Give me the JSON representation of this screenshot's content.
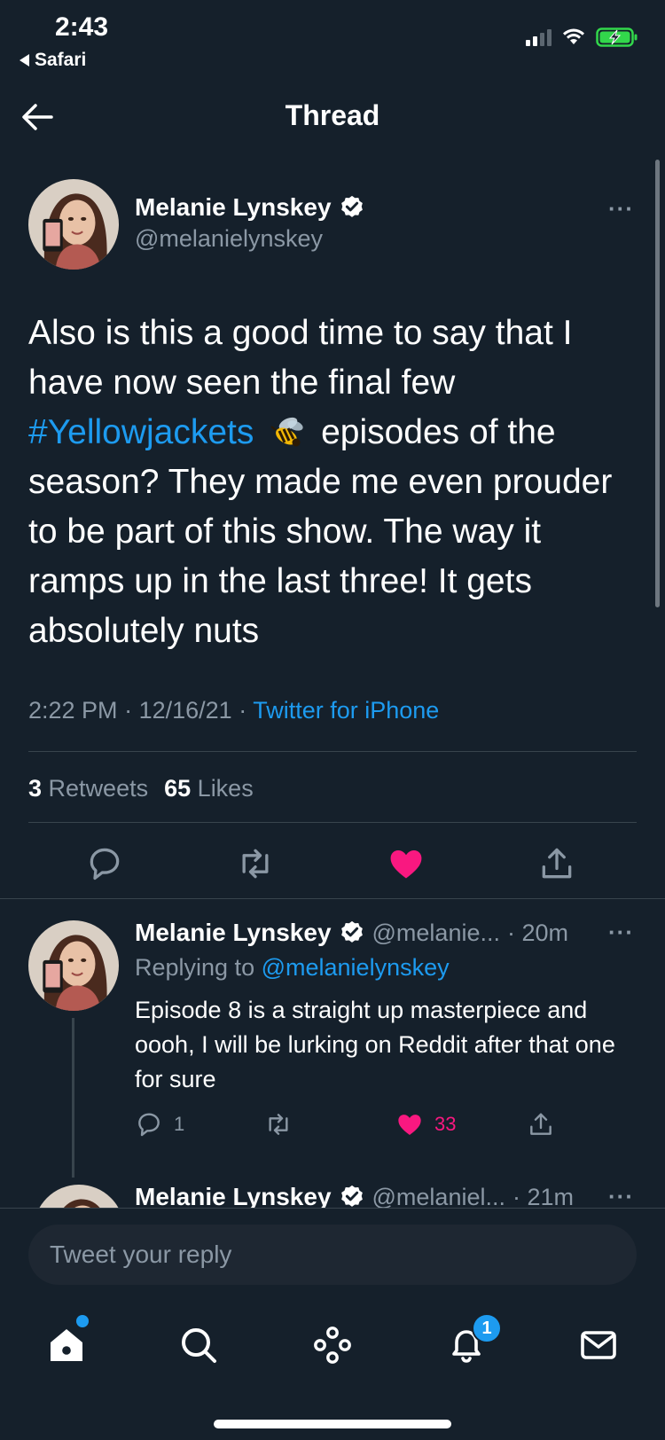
{
  "status_bar": {
    "time": "2:43",
    "back_app": "Safari"
  },
  "header": {
    "title": "Thread",
    "back_icon": "arrow-left-icon"
  },
  "main_tweet": {
    "author_name": "Melanie Lynskey",
    "handle": "@melanielynskey",
    "text_before_tag": "Also is this a good time to say that I have now seen the final few ",
    "hashtag": "#Yellowjackets",
    "hashtag_emoji": "bee-icon",
    "text_after_tag": " episodes of the season? They made me even prouder to be part of this show. The way it ramps up in the last three! It gets absolutely nuts",
    "time": "2:22 PM",
    "date": "12/16/21",
    "separator": "·",
    "source": "Twitter for iPhone",
    "retweets_count": "3",
    "retweets_label": "Retweets",
    "likes_count": "65",
    "likes_label": "Likes",
    "liked": true,
    "like_color": "#f91880"
  },
  "replies": [
    {
      "author_name": "Melanie Lynskey",
      "handle": "@melanie...",
      "age": "· 20m",
      "replying_to_label": "Replying to",
      "replying_to_handle": "@melanielynskey",
      "text": "Episode 8 is a straight up masterpiece and oooh, I will be lurking on Reddit after that one for sure",
      "reply_count": "1",
      "like_count": "33",
      "liked": true
    },
    {
      "author_name": "Melanie Lynskey",
      "handle": "@melaniel...",
      "age": "· 21m"
    }
  ],
  "composer": {
    "placeholder": "Tweet your reply"
  },
  "tab_bar": {
    "tabs": [
      "home-icon",
      "search-icon",
      "spaces-icon",
      "notifications-icon",
      "messages-icon"
    ],
    "notifications_badge": "1"
  },
  "more_label": "···",
  "colors": {
    "background": "#15202b",
    "accent": "#1d9bf0",
    "muted": "#8b98a5",
    "divider": "#38444d"
  }
}
